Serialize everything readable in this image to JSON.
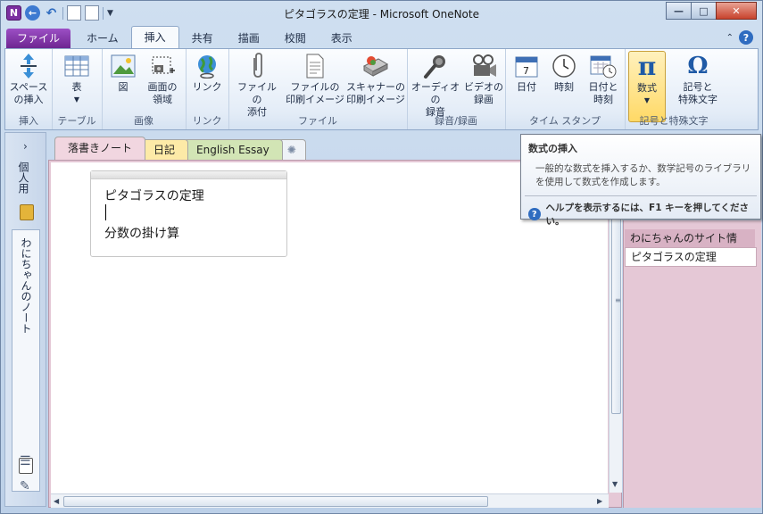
{
  "window": {
    "title": "ピタゴラスの定理 - Microsoft OneNote",
    "app_logo": "N",
    "controls": [
      "minimize-icon",
      "maximize-icon",
      "close-icon"
    ]
  },
  "ribbon_tabs": [
    "ファイル",
    "ホーム",
    "挿入",
    "共有",
    "描画",
    "校閲",
    "表示"
  ],
  "active_tab": "挿入",
  "ribbon_groups": {
    "insert_label": "挿入",
    "table_label": "テーブル",
    "image_label": "画像",
    "link_label": "リンク",
    "file_label": "ファイル",
    "av_label": "録音/録画",
    "timestamp_label": "タイム スタンプ",
    "symbol_label": "記号と特殊文字"
  },
  "ribbon_buttons": {
    "space_line1": "スペース",
    "space_line2": "の挿入",
    "table": "表",
    "picture": "図",
    "screen_line1": "画面の",
    "screen_line2": "領域",
    "link": "リンク",
    "attach_line1": "ファイルの",
    "attach_line2": "添付",
    "printout_line1": "ファイルの",
    "printout_line2": "印刷イメージ",
    "scanner_line1": "スキャナーの",
    "scanner_line2": "印刷イメージ",
    "audio_line1": "オーディオの",
    "audio_line2": "録音",
    "video_line1": "ビデオの",
    "video_line2": "録画",
    "date": "日付",
    "time": "時刻",
    "datetime_line1": "日付と",
    "datetime_line2": "時刻",
    "equation": "数式",
    "symbol_line1": "記号と",
    "symbol_line2": "特殊文字"
  },
  "tooltip": {
    "title": "数式の挿入",
    "body": "一般的な数式を挿入するか、数学記号のライブラリを使用して数式を作成します。",
    "help": "ヘルプを表示するには、F1 キーを押してください。"
  },
  "notebooks": {
    "personal": "個人用",
    "active": "わにちゃんのノート"
  },
  "section_tabs": [
    "落書きノート",
    "日記",
    "English Essay"
  ],
  "note": {
    "line1": "ピタゴラスの定理",
    "line2": "",
    "line3": "分数の掛け算"
  },
  "pages": [
    "わにちゃんのサイト情",
    "ピタゴラスの定理"
  ],
  "colors": {
    "file_tab": "#7b2fa0",
    "section_active": "#f1d6e0",
    "section_diary": "#fdeaa7",
    "section_essay": "#d2e5b5",
    "tooltip_bg": "#ffffff"
  }
}
